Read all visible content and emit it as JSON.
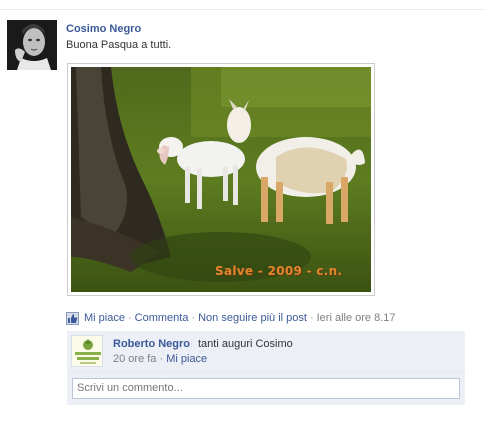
{
  "post": {
    "author": "Cosimo Negro",
    "message": "Buona Pasqua a tutti.",
    "photo_caption": "Salve - 2009 - c.n."
  },
  "actions": {
    "like": "Mi piace",
    "comment": "Commenta",
    "unfollow": "Non seguire più il post",
    "timestamp": "Ieri alle ore 8.17",
    "separator": "·"
  },
  "comments": [
    {
      "author": "Roberto Negro",
      "text": "tanti auguri Cosimo",
      "time": "20 ore fa",
      "like": "Mi piace",
      "avatar_text": "SAGRA CARCIOF"
    }
  ],
  "comment_input": {
    "placeholder": "Scrivi un commento..."
  },
  "colors": {
    "link": "#3b5998",
    "comment_bg": "#eceff5",
    "caption": "#e3862b"
  }
}
